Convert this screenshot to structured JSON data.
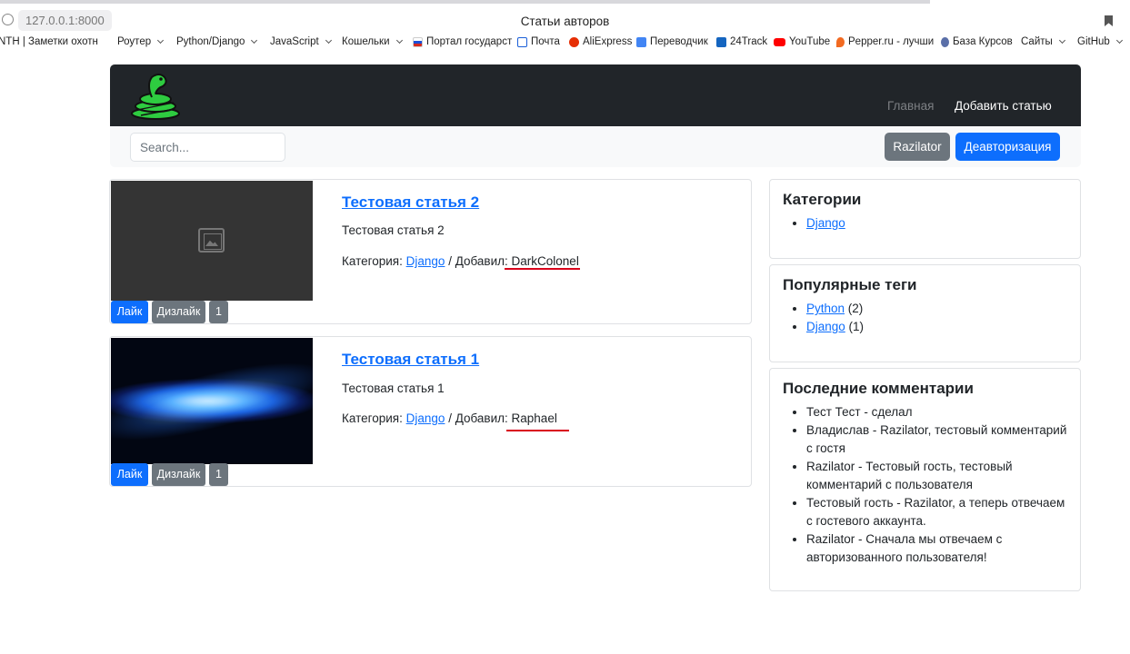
{
  "browser": {
    "url": "127.0.0.1:8000",
    "window_title": "Статьи авторов",
    "bookmarks": [
      {
        "label": "NTH | Заметки охотн",
        "dropdown": false,
        "icon": ""
      },
      {
        "label": "Роутер",
        "dropdown": true,
        "icon": ""
      },
      {
        "label": "Python/Django",
        "dropdown": true,
        "icon": ""
      },
      {
        "label": "JavaScript",
        "dropdown": true,
        "icon": ""
      },
      {
        "label": "Кошельки",
        "dropdown": true,
        "icon": ""
      },
      {
        "label": "Портал государст",
        "dropdown": false,
        "icon": "flag-ru-icon"
      },
      {
        "label": "Почта",
        "dropdown": false,
        "icon": "mail-icon"
      },
      {
        "label": "AliExpress",
        "dropdown": false,
        "icon": "aliexpress-icon"
      },
      {
        "label": "Переводчик",
        "dropdown": false,
        "icon": "translate-icon"
      },
      {
        "label": "24Track",
        "dropdown": false,
        "icon": "track-icon"
      },
      {
        "label": "YouTube",
        "dropdown": false,
        "icon": "youtube-icon"
      },
      {
        "label": "Pepper.ru - лучши",
        "dropdown": false,
        "icon": "pepper-icon"
      },
      {
        "label": "База Курсов",
        "dropdown": false,
        "icon": "courses-icon"
      },
      {
        "label": "Сайты",
        "dropdown": true,
        "icon": ""
      },
      {
        "label": "GitHub",
        "dropdown": true,
        "icon": ""
      }
    ]
  },
  "navbar": {
    "home_label": "Главная",
    "add_article_label": "Добавить статью",
    "brand_color": "#212529"
  },
  "toolbar": {
    "search_placeholder": "Search...",
    "user_button": "Razilator",
    "logout_button": "Деавторизация"
  },
  "articles": [
    {
      "title": "Тестовая статья 2",
      "description": "Тестовая статья 2",
      "category_prefix": "Категория:",
      "category": "Django",
      "added_by_prefix": "/ Добавил:",
      "author": "DarkColonel",
      "image": "placeholder-image-icon",
      "like_label": "Лайк",
      "dislike_label": "Дизлайк",
      "rating": "1"
    },
    {
      "title": "Тестовая статья 1",
      "description": "Тестовая статья 1",
      "category_prefix": "Категория:",
      "category": "Django",
      "added_by_prefix": "/ Добавил:",
      "author": "Raphael",
      "image": "galaxy-image",
      "like_label": "Лайк",
      "dislike_label": "Дизлайк",
      "rating": "1"
    }
  ],
  "sidebar": {
    "categories_title": "Категории",
    "categories": [
      "Django"
    ],
    "tags_title": "Популярные теги",
    "tags": [
      {
        "name": "Python",
        "count": "(2)"
      },
      {
        "name": "Django",
        "count": "(1)"
      }
    ],
    "comments_title": "Последние комментарии",
    "comments": [
      "Тест Тест - сделал",
      "Владислав - Razilator, тестовый комментарий с гостя",
      "Razilator - Тестовый гость, тестовый комментарий с пользователя",
      "Тестовый гость - Razilator, а теперь отвечаем с гостевого аккаунта.",
      "Razilator - Сначала мы отвечаем с авторизованного пользователя!"
    ]
  },
  "colors": {
    "primary": "#0d6efd",
    "secondary": "#6c757d",
    "annotation_underline": "#d9001b"
  }
}
